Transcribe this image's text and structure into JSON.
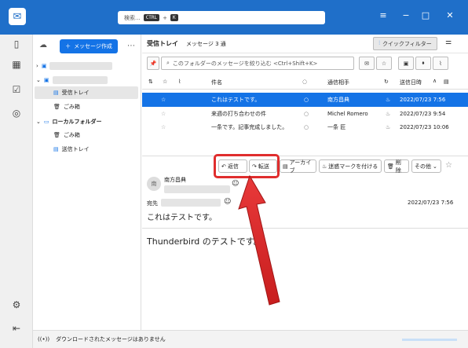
{
  "titlebar": {
    "search_placeholder": "検索...",
    "kbd1": "CTRL",
    "plus": "+",
    "kbd2": "K"
  },
  "folders": {
    "compose_label": "メッセージ作成",
    "items": [
      {
        "label": "受信トレイ"
      },
      {
        "label": "ごみ箱"
      },
      {
        "label": "ローカルフォルダー"
      },
      {
        "label": "ごみ箱"
      },
      {
        "label": "送信トレイ"
      }
    ]
  },
  "header": {
    "folder_title": "受信トレイ",
    "count": "メッセージ 3 通",
    "quick_filter": "クイックフィルター"
  },
  "filter": {
    "placeholder": "このフォルダーのメッセージを絞り込む <Ctrl+Shift+K>"
  },
  "columns": {
    "subject": "件名",
    "correspondent": "通信相手",
    "date": "送信日時"
  },
  "messages": [
    {
      "subject": "これはテストです。",
      "from": "南方昌典",
      "date": "2022/07/23 7:56"
    },
    {
      "subject": "来週の打ち合わせの件",
      "from": "Michel Romero",
      "date": "2022/07/23 9:54"
    },
    {
      "subject": "一条です。記事完成しました。",
      "from": "一条 匠",
      "date": "2022/07/23 10:06"
    }
  ],
  "preview": {
    "buttons": {
      "reply": "返信",
      "forward": "転送",
      "archive": "アーカイブ",
      "junk": "迷惑マークを付ける",
      "delete": "削除",
      "other": "その他"
    },
    "avatar": "南",
    "from_name": "南方昌典",
    "to_label": "宛先",
    "date": "2022/07/23 7:56",
    "subject": "これはテストです。",
    "body": "Thunderbird のテストです。"
  },
  "status": {
    "text": "ダウンロードされたメッセージはありません"
  }
}
